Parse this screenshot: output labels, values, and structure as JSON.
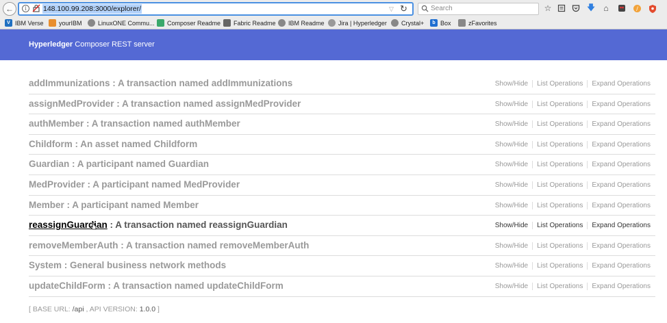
{
  "browser": {
    "url": "148.100.99.208:3000/explorer/",
    "search_placeholder": "Search",
    "bookmarks": [
      {
        "label": "IBM Verse",
        "icon": "ibm-verse-icon",
        "color": "#1f70c1"
      },
      {
        "label": "yourIBM",
        "icon": "youribm-icon",
        "color": "#e88e2e"
      },
      {
        "label": "LinuxONE Commu...",
        "icon": "globe-icon",
        "color": "#888888"
      },
      {
        "label": "Composer Readme",
        "icon": "composer-icon",
        "color": "#3aa86b"
      },
      {
        "label": "Fabric Readme",
        "icon": "document-icon",
        "color": "#666666"
      },
      {
        "label": "IBM Readme",
        "icon": "globe-icon",
        "color": "#888888"
      },
      {
        "label": "Jira | Hyperledger",
        "icon": "gear-icon",
        "color": "#999999"
      },
      {
        "label": "Crystal+",
        "icon": "globe-icon",
        "color": "#888888"
      },
      {
        "label": "Box",
        "icon": "box-icon",
        "color": "#1f6fd1"
      },
      {
        "label": "zFavorites",
        "icon": "link-icon",
        "color": "#888888"
      }
    ]
  },
  "header": {
    "title_bold": "Hyperledger",
    "title_rest": " Composer REST server",
    "color": "#5469d4"
  },
  "resources": [
    {
      "name": "addImmunizations",
      "desc": " : A transaction named addImmunizations"
    },
    {
      "name": "assignMedProvider",
      "desc": " : A transaction named assignMedProvider"
    },
    {
      "name": "authMember",
      "desc": " : A transaction named authMember"
    },
    {
      "name": "Childform",
      "desc": " : An asset named Childform"
    },
    {
      "name": "Guardian",
      "desc": " : A participant named Guardian"
    },
    {
      "name": "MedProvider",
      "desc": " : A participant named MedProvider"
    },
    {
      "name": "Member",
      "desc": " : A participant named Member"
    },
    {
      "name": "reassignGuardian",
      "desc": " : A transaction named reassignGuardian"
    },
    {
      "name": "removeMemberAuth",
      "desc": " : A transaction named removeMemberAuth"
    },
    {
      "name": "System",
      "desc": " : General business network methods"
    },
    {
      "name": "updateChildForm",
      "desc": " : A transaction named updateChildForm"
    }
  ],
  "operations": {
    "show_hide": "Show/Hide",
    "list": "List Operations",
    "expand": "Expand Operations"
  },
  "footer": {
    "open": "[ ",
    "base_url_label": "BASE URL: ",
    "base_url": "/api",
    "sep": " , ",
    "api_version_label": "API VERSION: ",
    "api_version": "1.0.0",
    "close": " ]"
  }
}
